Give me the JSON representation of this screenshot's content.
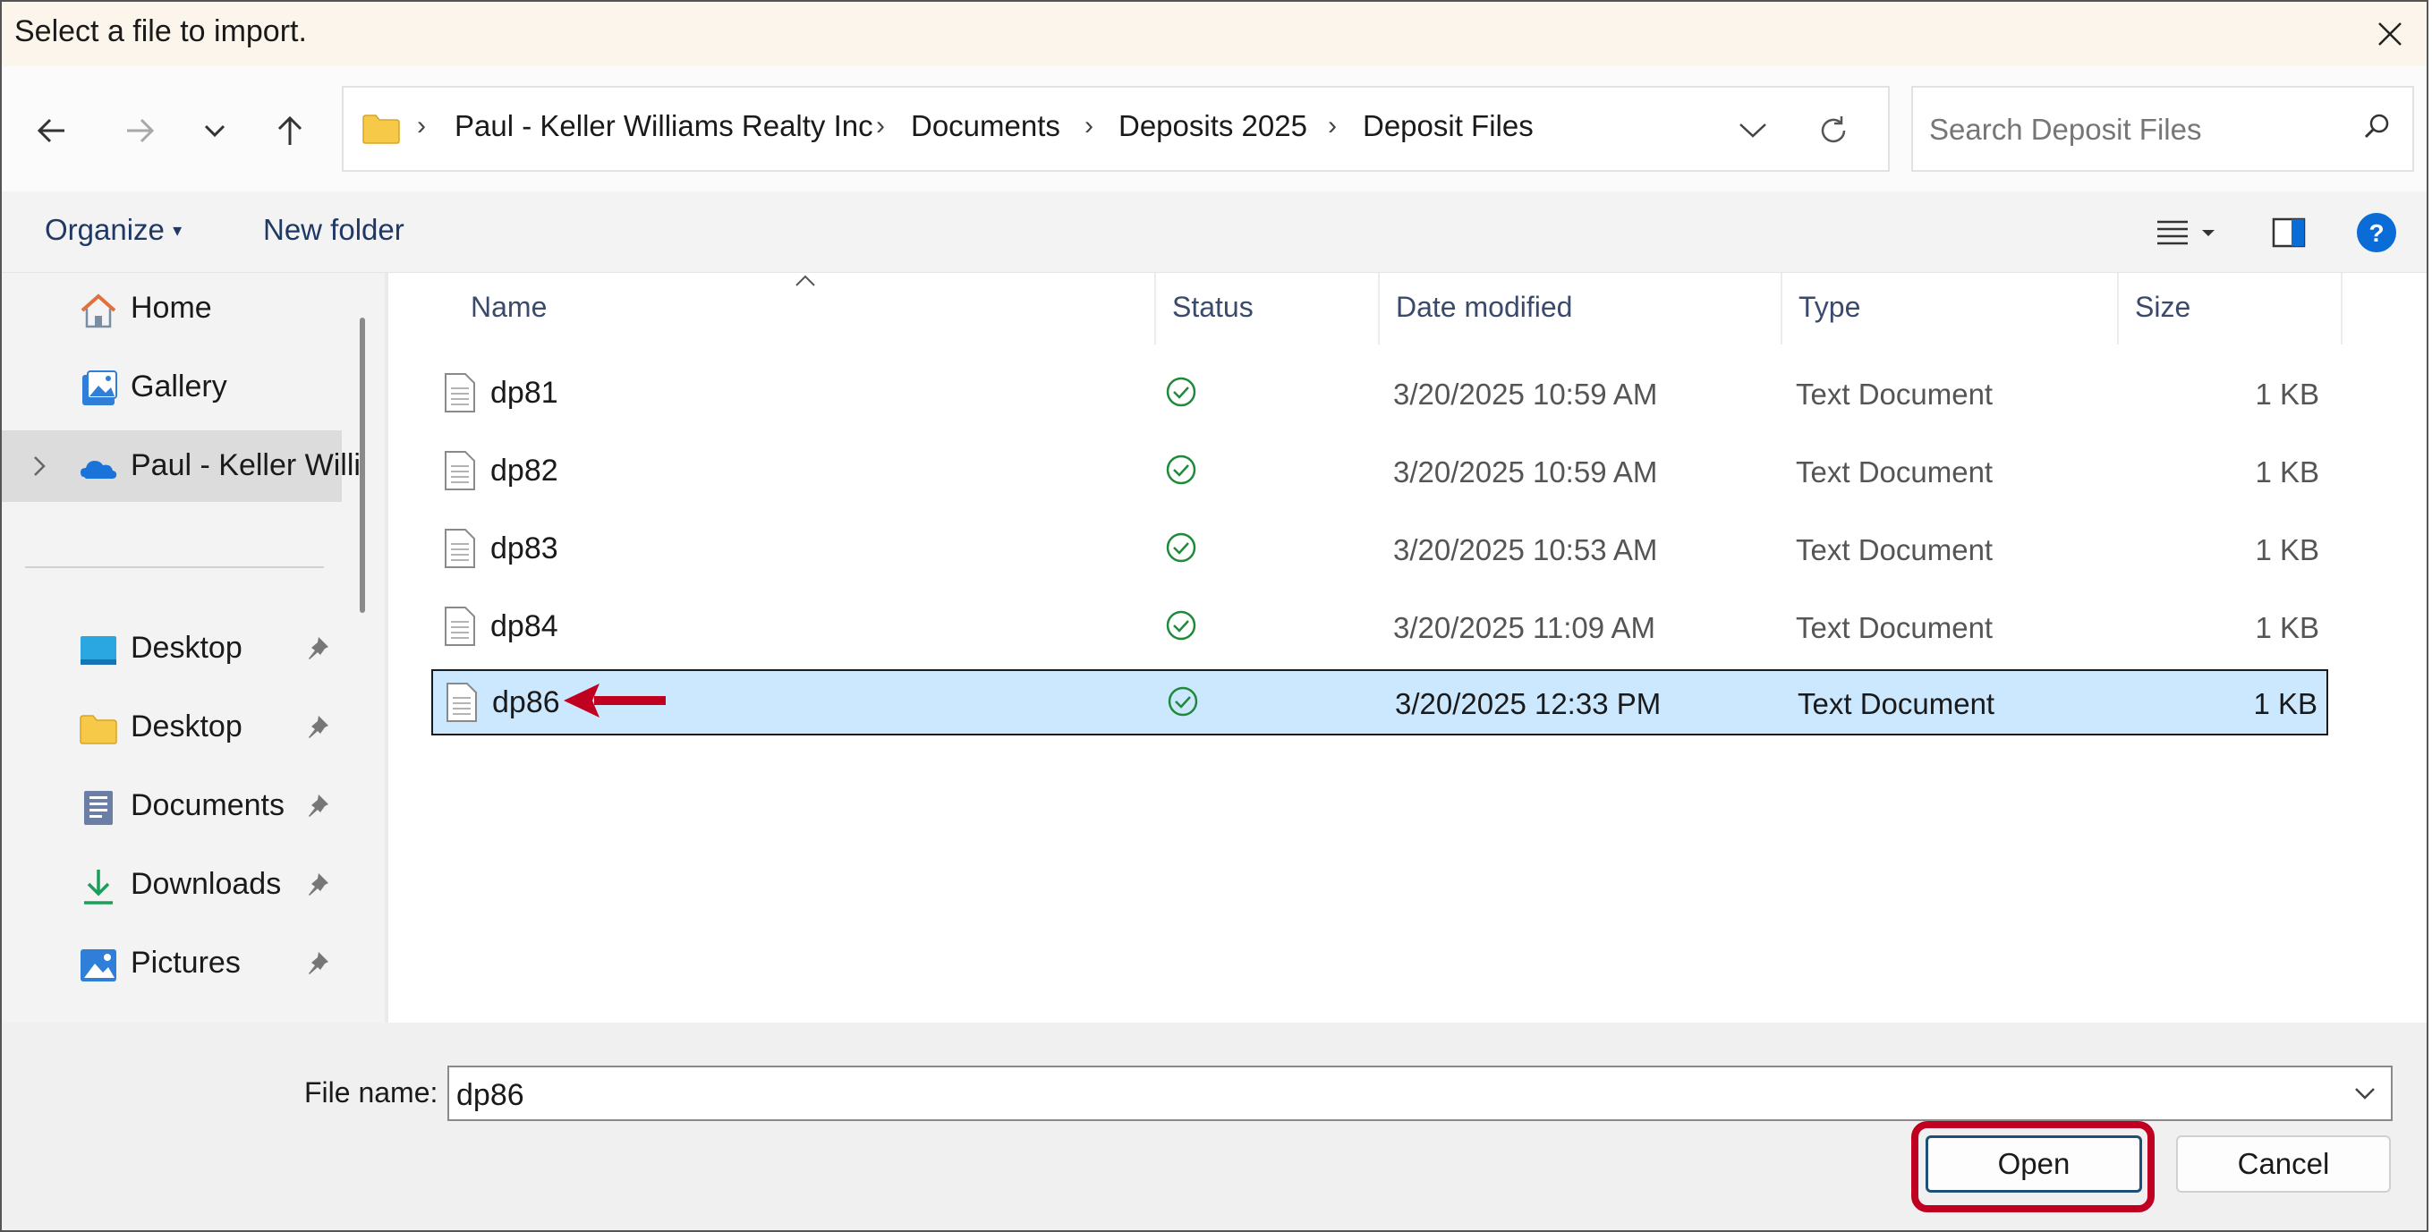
{
  "dialog": {
    "title": "Select a file to import."
  },
  "nav": {
    "breadcrumbs": [
      "Paul - Keller Williams Realty Inc",
      "Documents",
      "Deposits 2025",
      "Deposit Files"
    ],
    "search_placeholder": "Search Deposit Files"
  },
  "commands": {
    "organize": "Organize",
    "new_folder": "New folder"
  },
  "sidebar": {
    "items": [
      {
        "label": "Home",
        "icon": "home-icon"
      },
      {
        "label": "Gallery",
        "icon": "gallery-icon"
      },
      {
        "label": "Paul - Keller Willi",
        "icon": "onedrive-cloud-icon",
        "selected": true
      },
      {
        "label": "Desktop",
        "icon": "desktop-icon",
        "pinned": true
      },
      {
        "label": "Desktop",
        "icon": "folder-icon",
        "pinned": true
      },
      {
        "label": "Documents",
        "icon": "documents-icon",
        "pinned": true
      },
      {
        "label": "Downloads",
        "icon": "download-icon",
        "pinned": true
      },
      {
        "label": "Pictures",
        "icon": "pictures-icon",
        "pinned": true
      }
    ]
  },
  "columns": {
    "name": "Name",
    "status": "Status",
    "date": "Date modified",
    "type": "Type",
    "size": "Size"
  },
  "files": [
    {
      "name": "dp81",
      "date": "3/20/2025 10:59 AM",
      "type": "Text Document",
      "size": "1 KB"
    },
    {
      "name": "dp82",
      "date": "3/20/2025 10:59 AM",
      "type": "Text Document",
      "size": "1 KB"
    },
    {
      "name": "dp83",
      "date": "3/20/2025 10:53 AM",
      "type": "Text Document",
      "size": "1 KB"
    },
    {
      "name": "dp84",
      "date": "3/20/2025 11:09 AM",
      "type": "Text Document",
      "size": "1 KB"
    },
    {
      "name": "dp86",
      "date": "3/20/2025 12:33 PM",
      "type": "Text Document",
      "size": "1 KB",
      "selected": true
    }
  ],
  "footer": {
    "file_name_label": "File name:",
    "file_name_value": "dp86",
    "open_label": "Open",
    "cancel_label": "Cancel"
  },
  "colors": {
    "selection": "#cce8ff",
    "annotation_red": "#c00021",
    "status_green": "#1e8a3a",
    "help_blue": "#0a6cd6"
  }
}
